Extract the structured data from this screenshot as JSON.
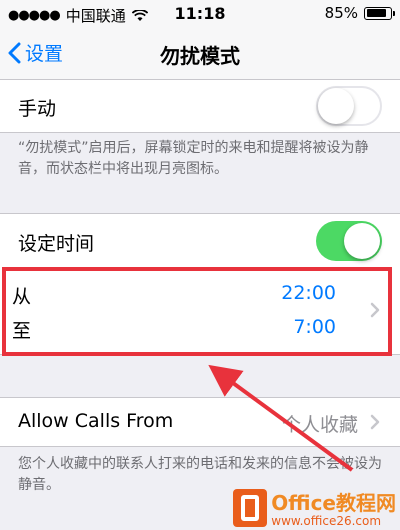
{
  "status_bar": {
    "signal": "●●●●●",
    "carrier": "中国联通",
    "time": "11:18",
    "battery_text": "85%",
    "battery_level": 0.85
  },
  "nav": {
    "back_label": "设置",
    "title": "勿扰模式"
  },
  "manual": {
    "label": "手动",
    "enabled": false,
    "footer": "“勿扰模式”启用后，屏幕锁定时的来电和提醒将被设为静音，而状态栏中将出现月亮图标。"
  },
  "schedule": {
    "label": "设定时间",
    "enabled": true,
    "from_label": "从",
    "from_value": "22:00",
    "to_label": "至",
    "to_value": "7:00"
  },
  "allow_calls": {
    "label": "Allow Calls From",
    "value": "个人收藏",
    "footer": "您个人收藏中的联系人打来的电话和发来的信息不会被设为静音。"
  },
  "watermark": {
    "main": "Office教程网",
    "sub": "www.office26.com"
  },
  "colors": {
    "accent": "#007aff",
    "switch_on": "#4cd964",
    "highlight": "#e8323c",
    "watermark": "#e95d1b"
  }
}
